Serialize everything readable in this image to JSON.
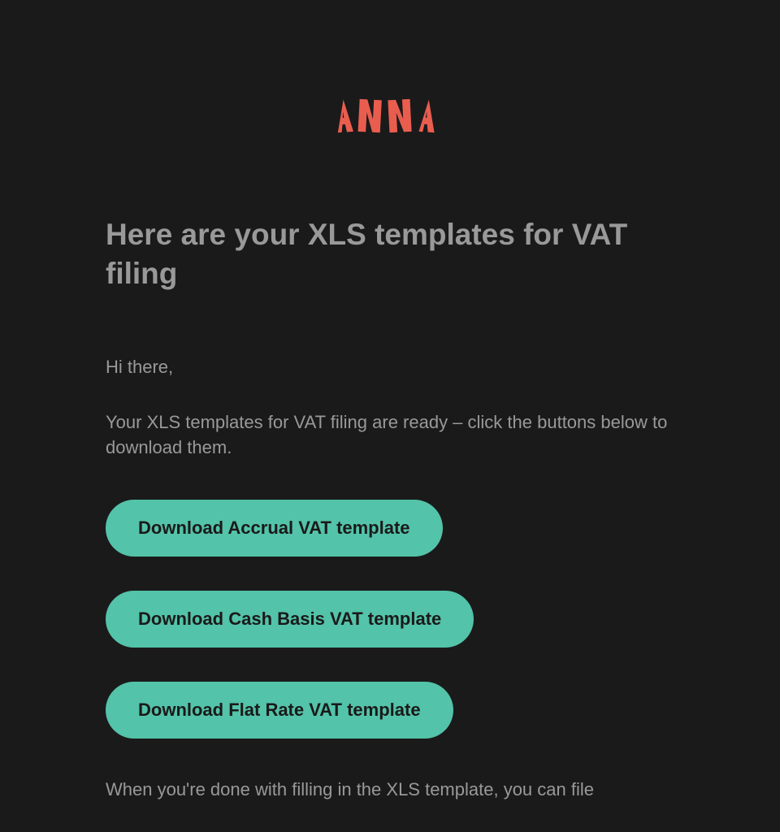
{
  "logo": {
    "text": "ANNA",
    "color": "#e95d4f"
  },
  "heading": "Here are your XLS templates for VAT filing",
  "greeting": "Hi there,",
  "body_text": "Your XLS templates for VAT filing are ready – click the buttons below to download them.",
  "buttons": [
    {
      "label": "Download Accrual VAT template"
    },
    {
      "label": "Download Cash Basis VAT template"
    },
    {
      "label": "Download Flat Rate VAT template"
    }
  ],
  "footer_text": "When you're done with filling in the XLS template, you can file"
}
